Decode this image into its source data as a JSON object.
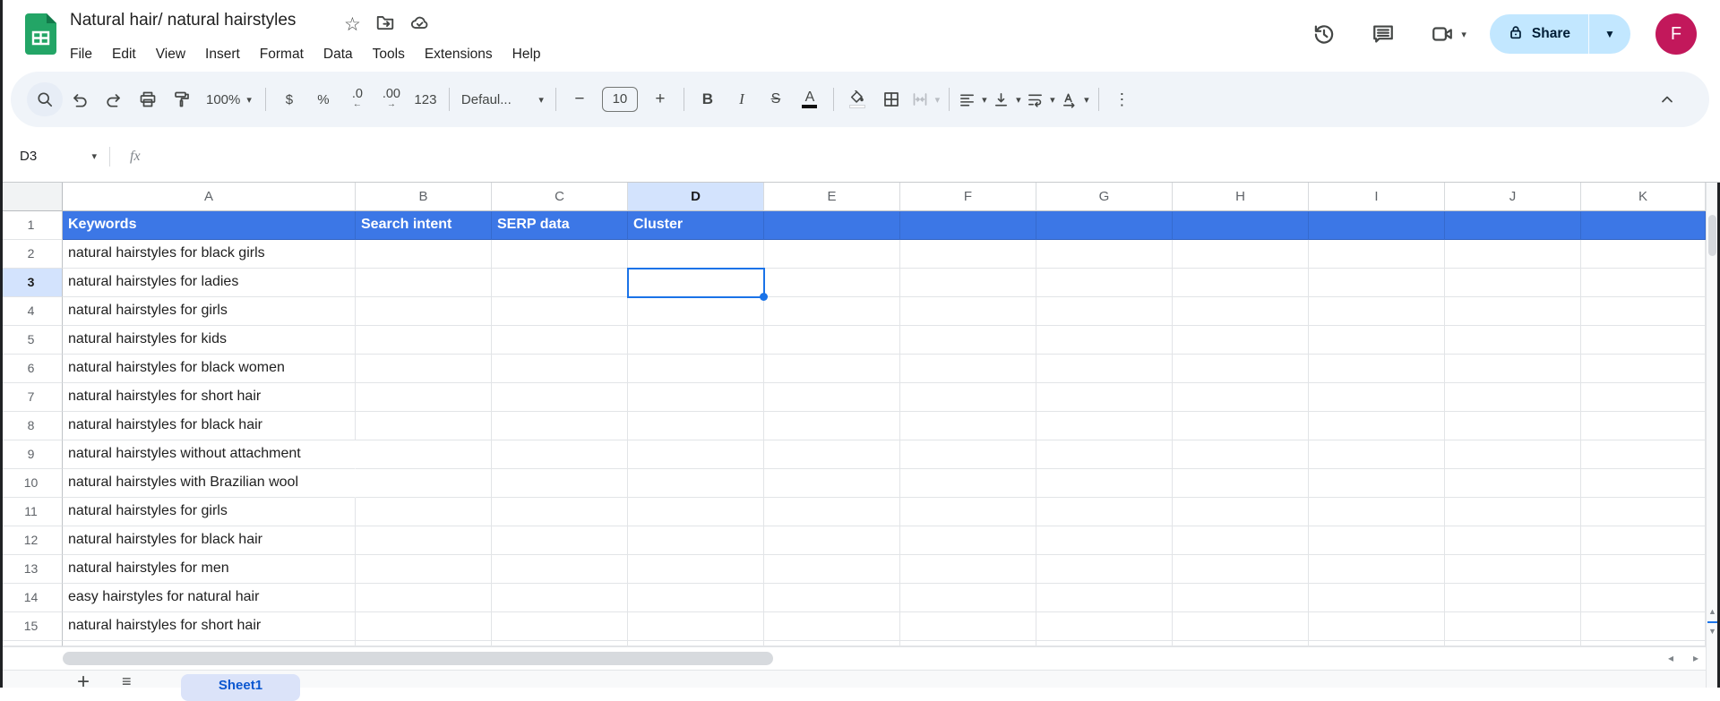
{
  "app": {
    "title": "Natural hair/ natural hairstyles",
    "menu_items": [
      "File",
      "Edit",
      "View",
      "Insert",
      "Format",
      "Data",
      "Tools",
      "Extensions",
      "Help"
    ],
    "share_label": "Share",
    "avatar_initial": "F"
  },
  "toolbar": {
    "zoom": "100%",
    "currency": "$",
    "percent": "%",
    "decimal_decrease": ".0",
    "decimal_increase": ".00",
    "more_formats": "123",
    "font": "Defaul...",
    "font_size": "10",
    "bold": "B",
    "italic": "I",
    "strikethrough": "S",
    "text_color": "A"
  },
  "formula_bar": {
    "cell_reference": "D3",
    "fx_label": "fx",
    "formula": ""
  },
  "grid": {
    "column_letters": [
      "A",
      "B",
      "C",
      "D",
      "E",
      "F",
      "G",
      "H",
      "I",
      "J",
      "K"
    ],
    "active_cell": "D3",
    "active_column": "D",
    "active_row": 3,
    "header_row": {
      "row": 1,
      "labels": [
        "Keywords",
        "Search intent",
        "SERP data",
        "Cluster"
      ]
    },
    "rows": [
      {
        "n": 2,
        "keyword": "natural hairstyles for black girls"
      },
      {
        "n": 3,
        "keyword": "natural hairstyles for ladies"
      },
      {
        "n": 4,
        "keyword": "natural hairstyles for girls"
      },
      {
        "n": 5,
        "keyword": "natural hairstyles for kids"
      },
      {
        "n": 6,
        "keyword": "natural hairstyles for black women"
      },
      {
        "n": 7,
        "keyword": "natural hairstyles for short hair"
      },
      {
        "n": 8,
        "keyword": "natural hairstyles for black hair"
      },
      {
        "n": 9,
        "keyword": "natural hairstyles without attachment",
        "overflow": true
      },
      {
        "n": 10,
        "keyword": "natural hairstyles with Brazilian wool",
        "overflow": true
      },
      {
        "n": 11,
        "keyword": "natural hairstyles for girls"
      },
      {
        "n": 12,
        "keyword": "natural hairstyles for black hair"
      },
      {
        "n": 13,
        "keyword": "natural hairstyles for men"
      },
      {
        "n": 14,
        "keyword": "easy hairstyles for natural hair"
      },
      {
        "n": 15,
        "keyword": "natural hairstyles for short hair"
      }
    ]
  },
  "sheet_bar": {
    "active_tab": "Sheet1"
  },
  "colors": {
    "row1_fill": "#3c77e6",
    "selection": "#1a73e8",
    "active_header_bg": "#d3e3fd",
    "share_button_bg": "#c2e7ff",
    "avatar_bg": "#c2185b",
    "logo_green": "#23a566"
  }
}
